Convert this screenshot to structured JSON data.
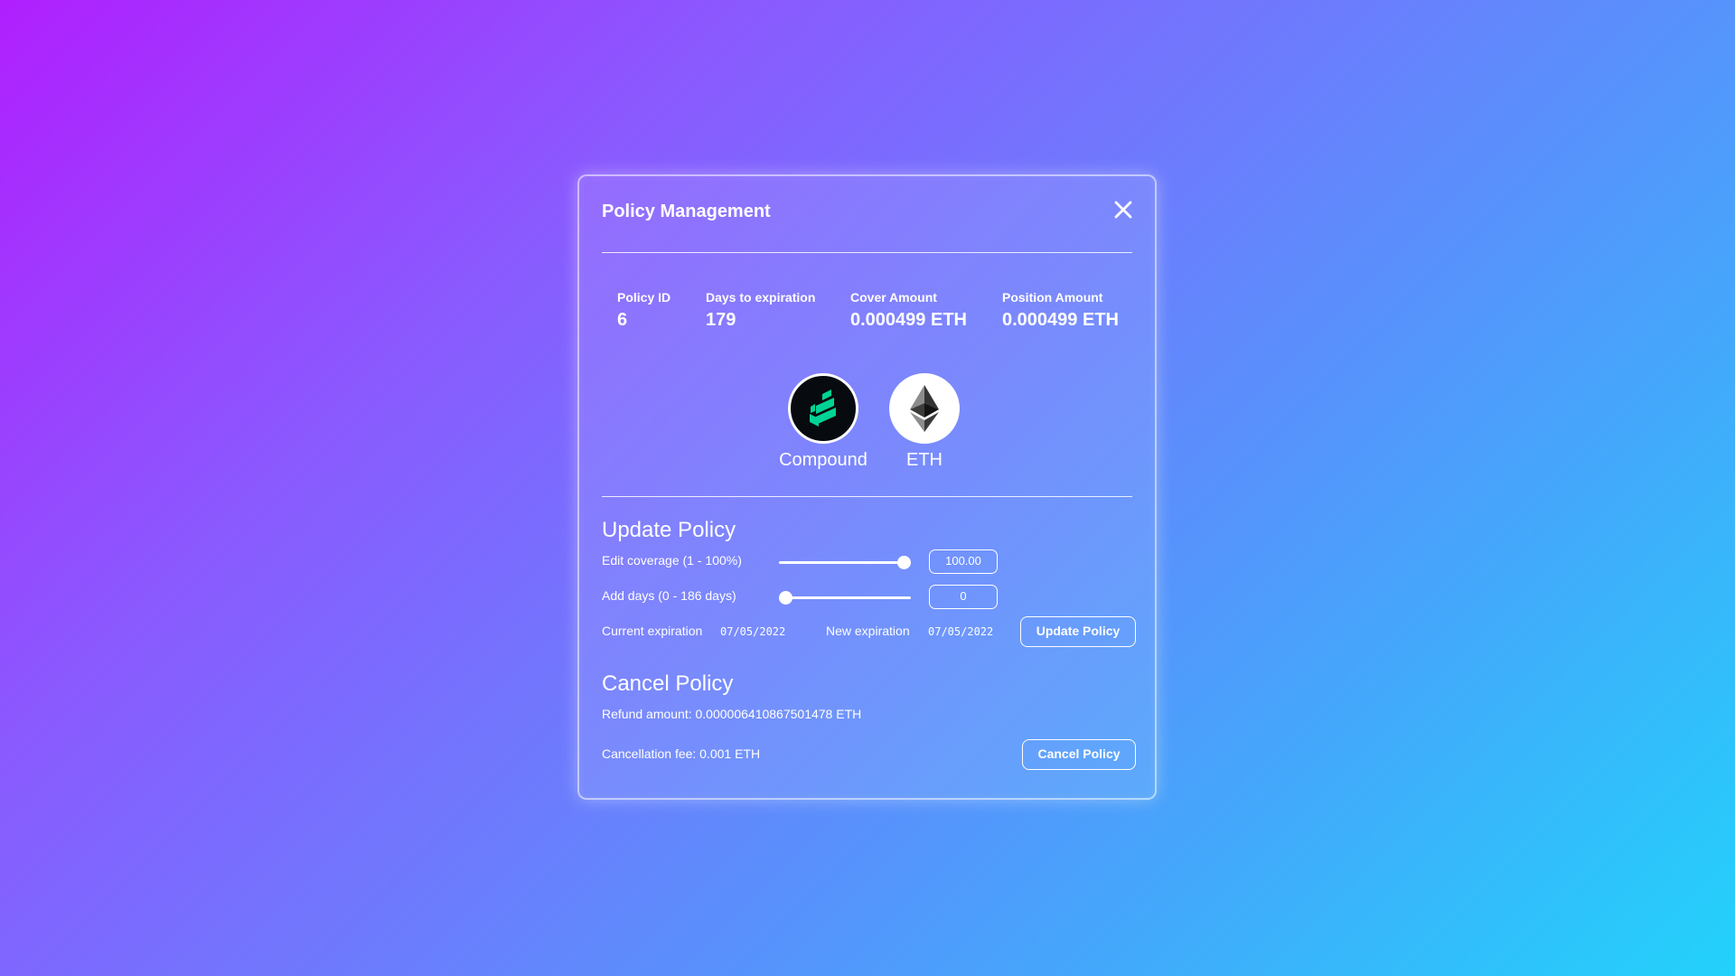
{
  "modal": {
    "title": "Policy Management"
  },
  "stats": {
    "policy_id_label": "Policy ID",
    "policy_id_value": "6",
    "days_label": "Days to expiration",
    "days_value": "179",
    "cover_label": "Cover Amount",
    "cover_value": "0.000499 ETH",
    "position_label": "Position Amount",
    "position_value": "0.000499 ETH"
  },
  "tokens": [
    {
      "name": "Compound",
      "icon": "compound-logo-icon"
    },
    {
      "name": "ETH",
      "icon": "ethereum-logo-icon"
    }
  ],
  "update": {
    "title": "Update Policy",
    "coverage_label": "Edit coverage (1 - 100%)",
    "coverage_value": "100.00",
    "coverage_level": 1.0,
    "days_label": "Add days (0 - 186 days)",
    "days_value": "0",
    "days_level": 0.0,
    "current_exp_label": "Current expiration",
    "current_exp_value": "07/05/2022",
    "new_exp_label": "New expiration",
    "new_exp_value": "07/05/2022",
    "button_label": "Update Policy"
  },
  "cancel": {
    "title": "Cancel Policy",
    "refund_text": "Refund amount: 0.000006410867501478 ETH",
    "fee_text": "Cancellation fee: 0.001 ETH",
    "button_label": "Cancel Policy"
  },
  "colors": {
    "compound_bg": "#070a0e",
    "compound_green": "#00d395",
    "eth_bg": "#ffffff"
  }
}
